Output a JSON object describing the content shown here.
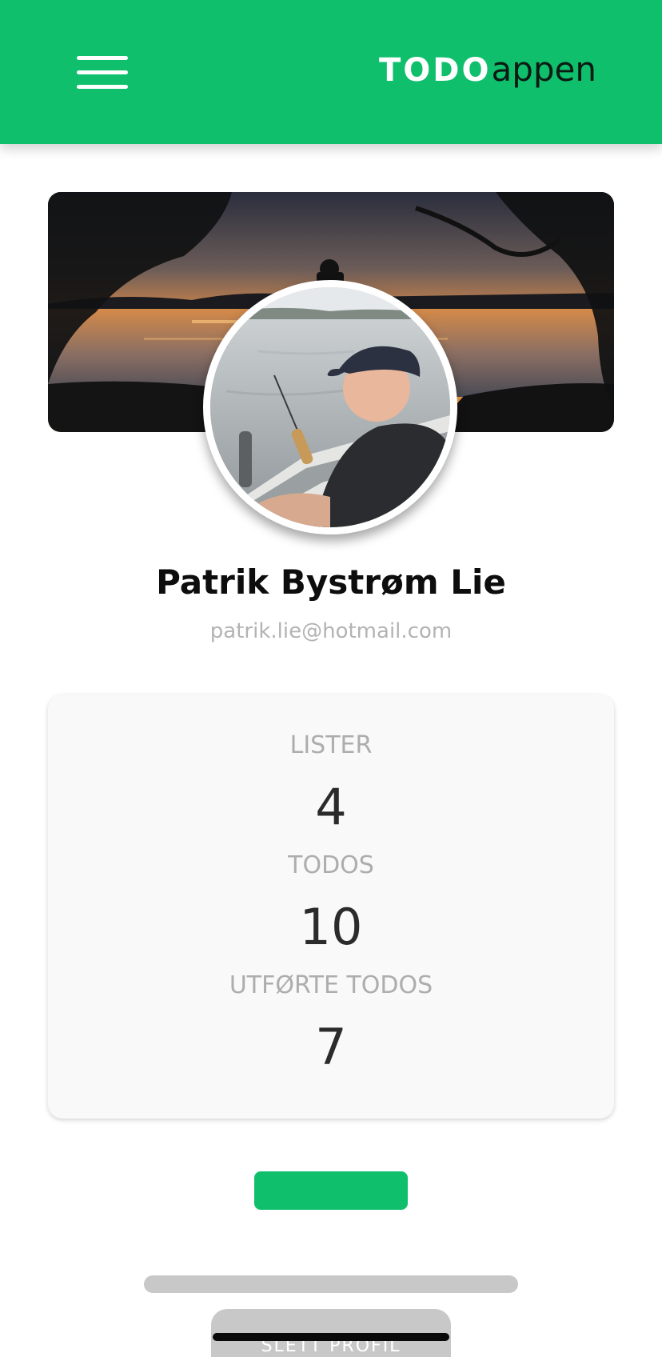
{
  "header": {
    "logo_bold": "TODO",
    "logo_light": "appen",
    "background_color": "#10bf6c",
    "menu_icon": "hamburger-menu-icon"
  },
  "profile": {
    "name": "Patrik Bystrøm Lie",
    "email": "patrik.lie@hotmail.com"
  },
  "stats": [
    {
      "label": "LISTER",
      "value": "4"
    },
    {
      "label": "TODOS",
      "value": "10"
    },
    {
      "label": "UTFØRTE TODOS",
      "value": "7"
    }
  ],
  "actions": {
    "delete_label": "SLETT PROFIL",
    "accent_color": "#10bf6c"
  }
}
